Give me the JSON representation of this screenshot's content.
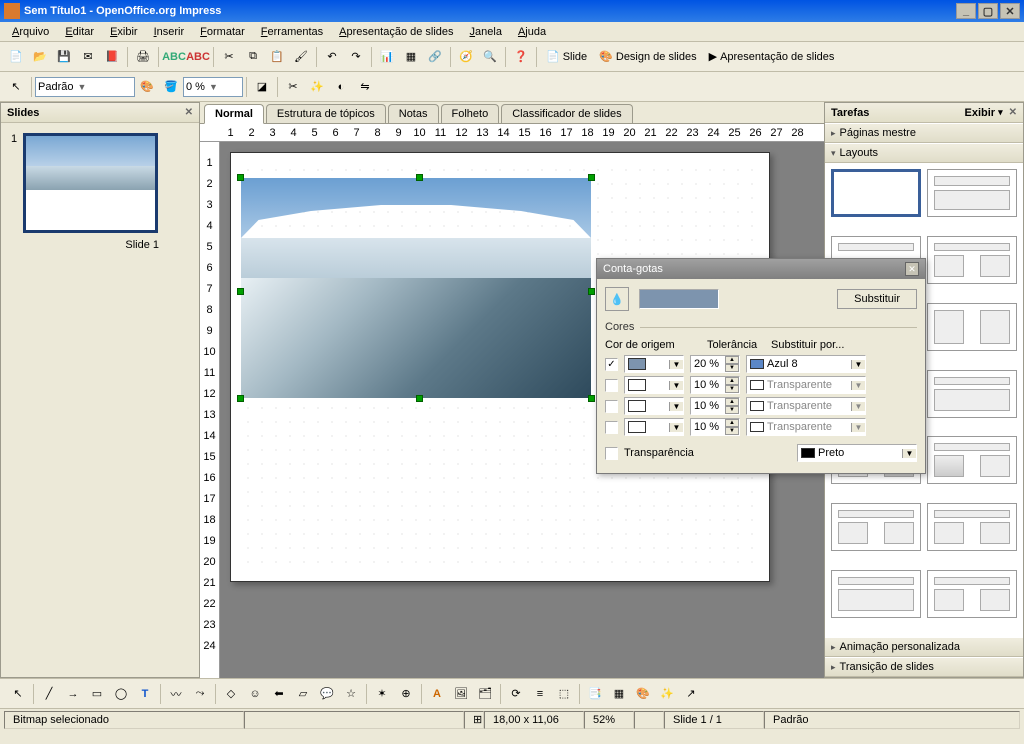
{
  "window": {
    "title": "Sem Título1 - OpenOffice.org Impress"
  },
  "menu": {
    "items": [
      "Arquivo",
      "Editar",
      "Exibir",
      "Inserir",
      "Formatar",
      "Ferramentas",
      "Apresentação de slides",
      "Janela",
      "Ajuda"
    ]
  },
  "toolbar2": {
    "style_label": "Padrão",
    "zoom_value": "0 %"
  },
  "toolbar_links": {
    "slide": "Slide",
    "design": "Design de slides",
    "presentation": "Apresentação de slides"
  },
  "slides_panel": {
    "title": "Slides",
    "slide1_num": "1",
    "slide1_caption": "Slide 1"
  },
  "viewtabs": {
    "items": [
      "Normal",
      "Estrutura de tópicos",
      "Notas",
      "Folheto",
      "Classificador de slides"
    ]
  },
  "ruler_h": [
    "1",
    "2",
    "3",
    "4",
    "5",
    "6",
    "7",
    "8",
    "9",
    "10",
    "11",
    "12",
    "13",
    "14",
    "15",
    "16",
    "17",
    "18",
    "19",
    "20",
    "21",
    "22",
    "23",
    "24",
    "25",
    "26",
    "27",
    "28"
  ],
  "ruler_v": [
    "1",
    "2",
    "3",
    "4",
    "5",
    "6",
    "7",
    "8",
    "9",
    "10",
    "11",
    "12",
    "13",
    "14",
    "15",
    "16",
    "17",
    "18",
    "19",
    "20",
    "21",
    "22",
    "23",
    "24"
  ],
  "tasks": {
    "title": "Tarefas",
    "view_label": "Exibir",
    "sections": {
      "master": "Páginas mestre",
      "layouts": "Layouts",
      "anim": "Animação personalizada",
      "trans": "Transição de slides"
    }
  },
  "dialog": {
    "title": "Conta-gotas",
    "substitute_btn": "Substituir",
    "colors_group": "Cores",
    "headers": {
      "source": "Cor de origem",
      "tolerance": "Tolerância",
      "replace": "Substituir por..."
    },
    "rows": [
      {
        "checked": true,
        "tolerance": "20 %",
        "replace": "Azul 8",
        "replace_color": "#5b87c7",
        "swatch": "#7d94ae",
        "disabled": false
      },
      {
        "checked": false,
        "tolerance": "10 %",
        "replace": "Transparente",
        "replace_color": "#ffffff",
        "swatch": "#ffffff",
        "disabled": true
      },
      {
        "checked": false,
        "tolerance": "10 %",
        "replace": "Transparente",
        "replace_color": "#ffffff",
        "swatch": "#ffffff",
        "disabled": true
      },
      {
        "checked": false,
        "tolerance": "10 %",
        "replace": "Transparente",
        "replace_color": "#ffffff",
        "swatch": "#ffffff",
        "disabled": true
      }
    ],
    "transparency_label": "Transparência",
    "transparency_replace": "Preto",
    "transparency_color": "#000000"
  },
  "statusbar": {
    "selection": "Bitmap selecionado",
    "pos": "18,00 x 11,06",
    "zoom": "52%",
    "page": "Slide 1 / 1",
    "mode": "Padrão"
  }
}
